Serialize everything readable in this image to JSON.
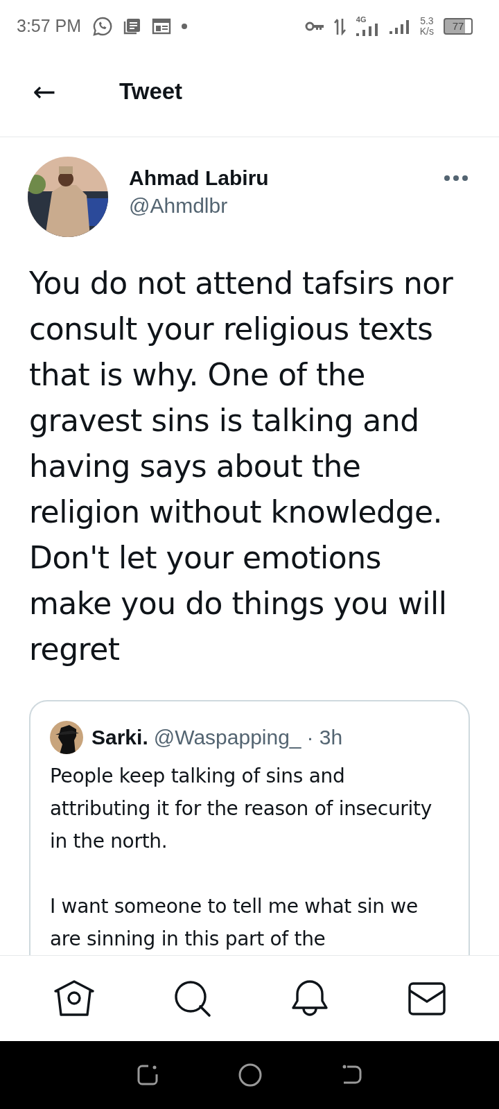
{
  "status_bar": {
    "time": "3:57 PM",
    "network": "4G",
    "speed_value": "5.3",
    "speed_unit": "K/s",
    "battery": "77"
  },
  "header": {
    "back": "←",
    "title": "Tweet"
  },
  "tweet": {
    "author": {
      "name": "Ahmad Labiru",
      "handle": "@Ahmdlbr",
      "avatar": {
        "kind": "picture"
      }
    },
    "text": "You do not attend tafsirs nor consult your religious texts that is why. One of the gravest sins is talking and having says about the religion without knowledge. Don't let your emotions make you do things you will regret",
    "quoted": {
      "name": "Sarki.",
      "handle": "@Waspapping_",
      "time": "· 3h",
      "avatar": {
        "kind": "picture"
      },
      "paragraphs": [
        "People keep talking of sins and attributing it for the reason of insecurity in the north.",
        "I want someone to tell me what sin we are sinning in this part of the"
      ]
    }
  },
  "bottom_nav": [
    {
      "kind": "home"
    },
    {
      "kind": "search"
    },
    {
      "kind": "notifications"
    },
    {
      "kind": "messages"
    }
  ],
  "system_nav": [
    {
      "kind": "recents"
    },
    {
      "kind": "home"
    },
    {
      "kind": "back"
    }
  ]
}
